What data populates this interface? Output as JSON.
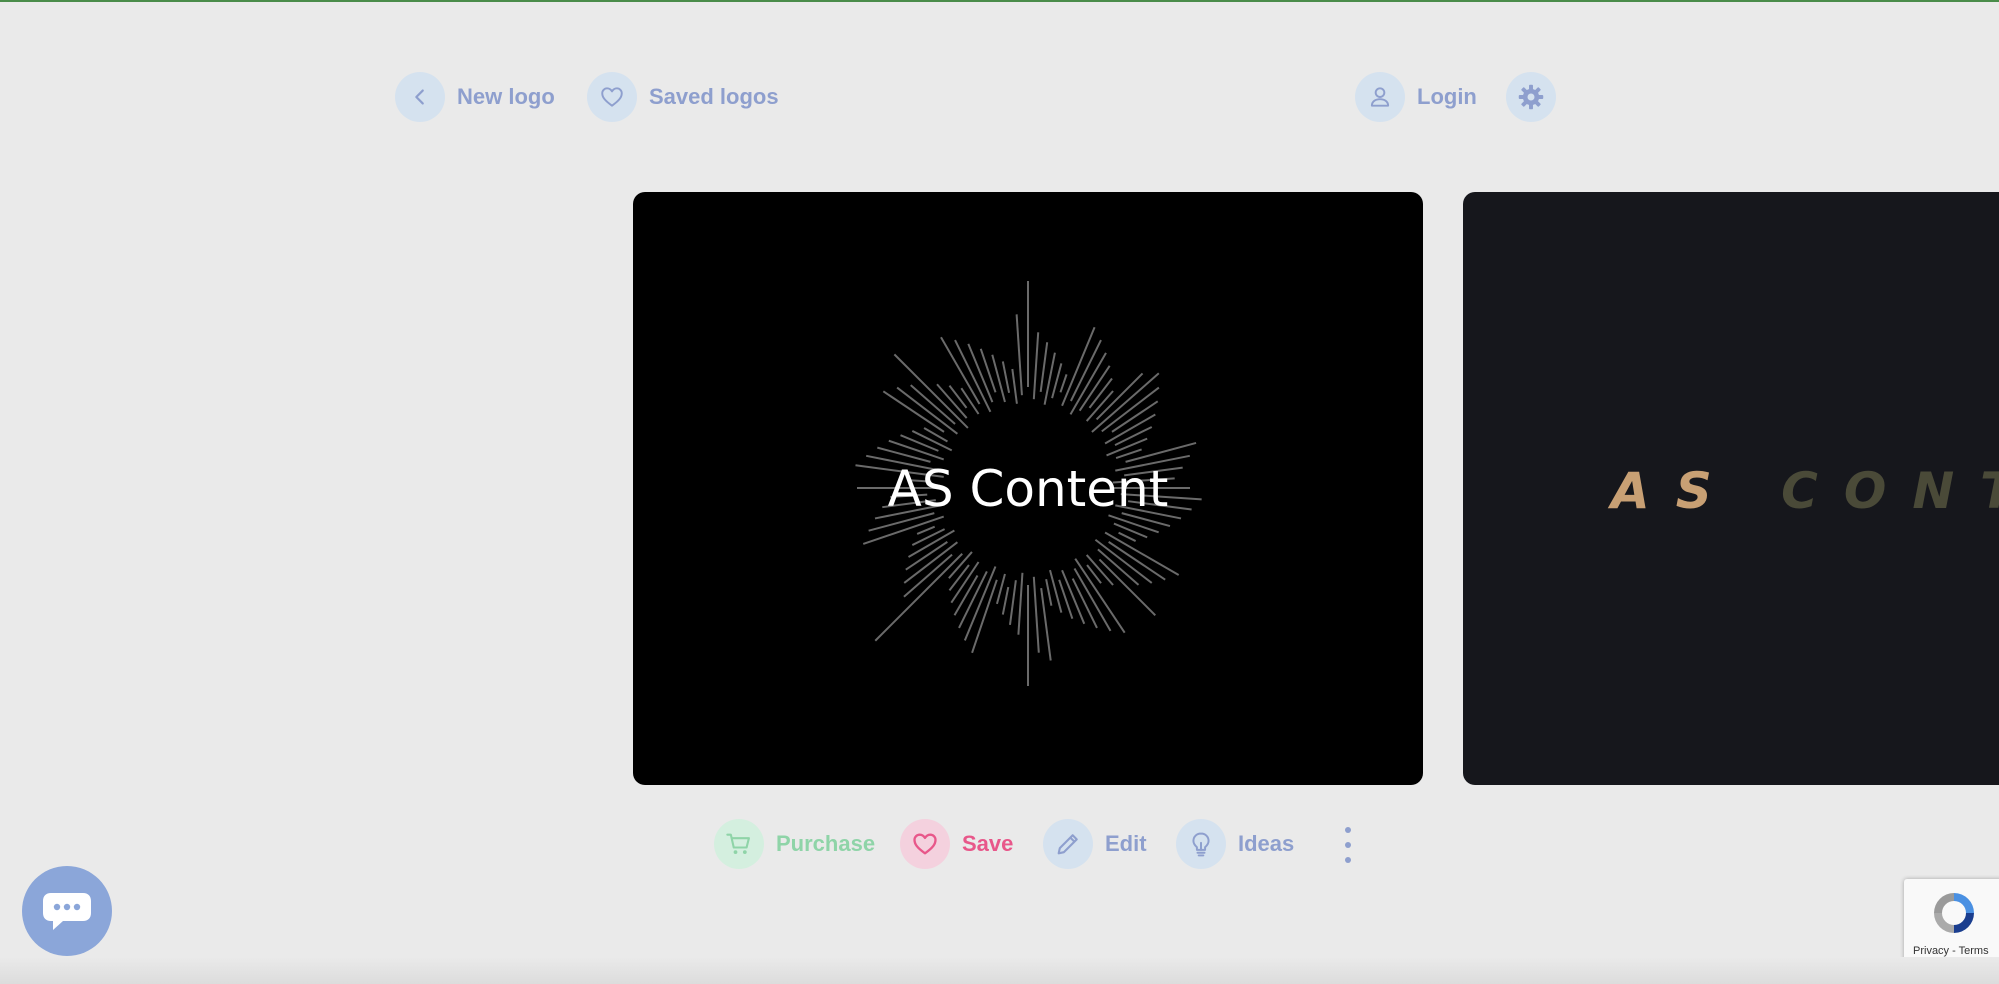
{
  "header": {
    "new_logo_label": "New logo",
    "saved_logos_label": "Saved logos",
    "login_label": "Login"
  },
  "cards": {
    "main_logo_text": "AS Content",
    "next_logo_text_a": "AS",
    "next_logo_text_b": "CONTE"
  },
  "actions": {
    "purchase_label": "Purchase",
    "save_label": "Save",
    "edit_label": "Edit",
    "ideas_label": "Ideas"
  },
  "recaptcha": {
    "privacy_label": "Privacy",
    "separator": " - ",
    "terms_label": "Terms"
  },
  "colors": {
    "background": "#eaeaea",
    "accent_blue": "#8e9fce",
    "purchase_green": "#8fd4a8",
    "save_pink": "#e8578a",
    "chat_blue": "#8ba6d9"
  },
  "icons": {
    "new_logo": "chevron-left-icon",
    "saved_logos": "heart-icon",
    "login": "user-icon",
    "settings": "gear-icon",
    "purchase": "cart-icon",
    "save": "heart-icon",
    "edit": "pencil-icon",
    "ideas": "lightbulb-icon",
    "more": "more-vertical-icon",
    "chat": "chat-bubble-icon",
    "recaptcha": "recaptcha-icon"
  }
}
